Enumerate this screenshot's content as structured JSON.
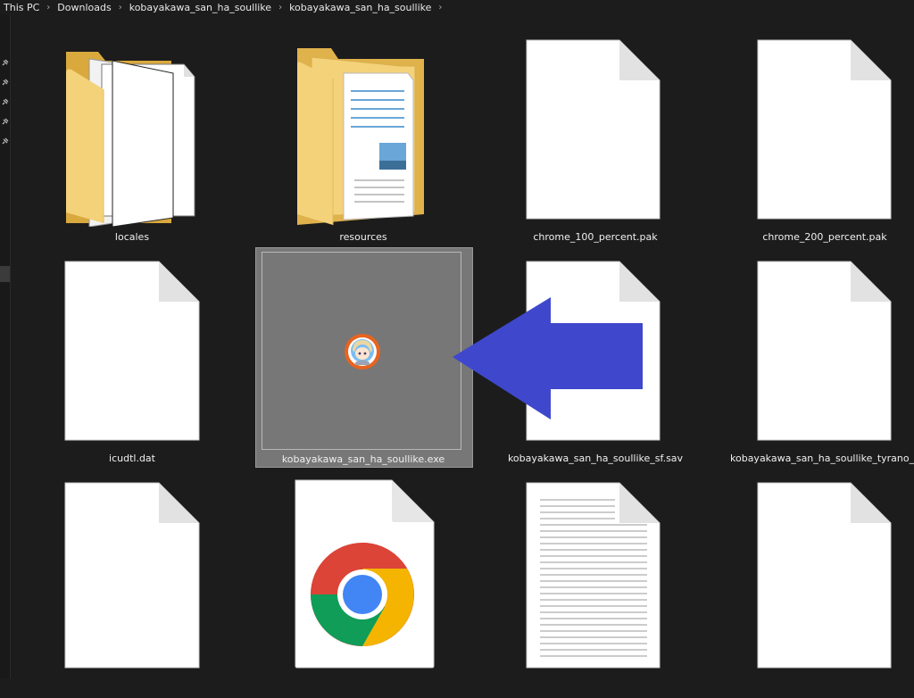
{
  "breadcrumb": {
    "items": [
      "This PC",
      "Downloads",
      "kobayakawa_san_ha_soullike",
      "kobayakawa_san_ha_soullike"
    ]
  },
  "files": [
    {
      "name": "locales",
      "type": "folder"
    },
    {
      "name": "resources",
      "type": "folder"
    },
    {
      "name": "chrome_100_percent.pak",
      "type": "file"
    },
    {
      "name": "chrome_200_percent.pak",
      "type": "file"
    },
    {
      "name": "icudtl.dat",
      "type": "file"
    },
    {
      "name": "kobayakawa_san_ha_soullike.exe",
      "type": "exe",
      "selected": true
    },
    {
      "name": "kobayakawa_san_ha_soullike_sf.sav",
      "type": "file"
    },
    {
      "name": "kobayakawa_san_ha_soullike_tyrano_data.sav",
      "type": "file"
    },
    {
      "name": "",
      "type": "file"
    },
    {
      "name": "",
      "type": "chrome"
    },
    {
      "name": "",
      "type": "text"
    },
    {
      "name": "",
      "type": "file"
    }
  ],
  "colors": {
    "background": "#1c1c1c",
    "selection": "#777777",
    "arrow": "#3f48cc",
    "folder": "#f4d27a"
  }
}
